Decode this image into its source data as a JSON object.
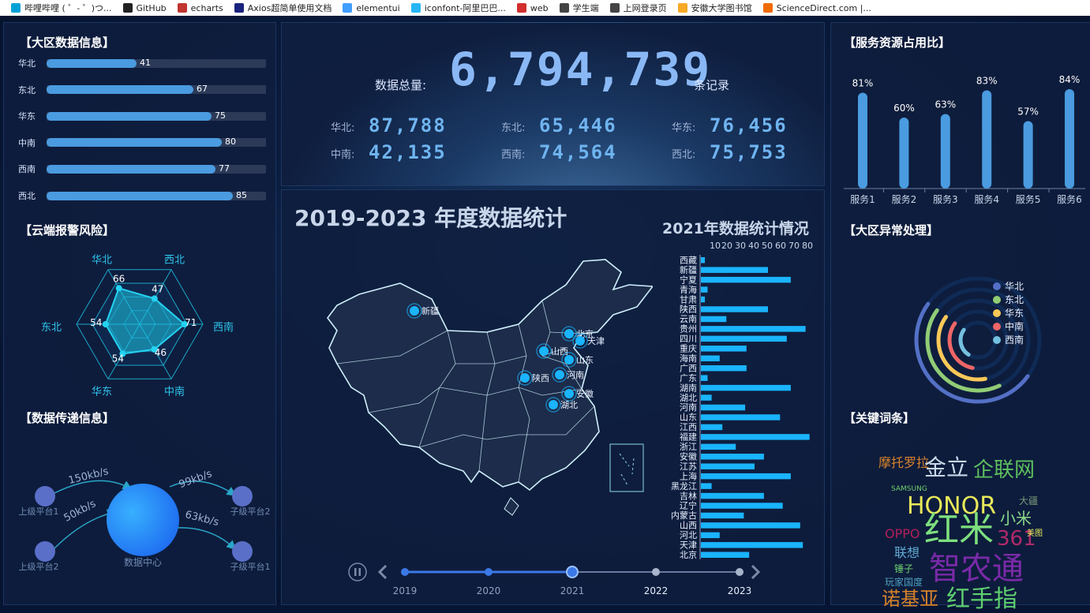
{
  "bookmarks": [
    {
      "label": "哔哩哔哩 ( ゜- ゜)つ...",
      "color": "#00a1d6"
    },
    {
      "label": "GitHub",
      "color": "#222222"
    },
    {
      "label": "echarts",
      "color": "#c23531"
    },
    {
      "label": "Axios超简单使用文档",
      "color": "#1a237e"
    },
    {
      "label": "elementui",
      "color": "#409eff"
    },
    {
      "label": "iconfont-阿里巴巴...",
      "color": "#29b6f6"
    },
    {
      "label": "web",
      "color": "#d32f2f"
    },
    {
      "label": "学生端",
      "color": "#444444"
    },
    {
      "label": "上网登录页",
      "color": "#444444"
    },
    {
      "label": "安徽大学图书馆",
      "color": "#f9a825"
    },
    {
      "label": "ScienceDirect.com |...",
      "color": "#ef6c00"
    }
  ],
  "left": {
    "region_title": "【大区数据信息】",
    "region_bars": [
      {
        "label": "华北",
        "value": 41
      },
      {
        "label": "东北",
        "value": 67
      },
      {
        "label": "华东",
        "value": 75
      },
      {
        "label": "中南",
        "value": 80
      },
      {
        "label": "西南",
        "value": 77
      },
      {
        "label": "西北",
        "value": 85
      }
    ],
    "radar_title": "【云端报警风险】",
    "radar": {
      "axes": [
        "华北",
        "西北",
        "西南",
        "中南",
        "华东",
        "东北"
      ],
      "values": [
        66,
        47,
        71,
        46,
        54,
        54
      ]
    },
    "transfer_title": "【数据传递信息】",
    "transfer": {
      "center": "数据中心",
      "nodes": [
        "上级平台1",
        "上级平台2",
        "子级平台2",
        "子级平台1"
      ],
      "rates": [
        "150kb/s",
        "50kb/s",
        "99kb/s",
        "63kb/s"
      ]
    }
  },
  "top": {
    "total_label": "数据总量:",
    "total_value": "6,794,739",
    "total_unit": "条记录",
    "regions": [
      {
        "label": "华北:",
        "value": "87,788"
      },
      {
        "label": "东北:",
        "value": "65,446"
      },
      {
        "label": "华东:",
        "value": "76,456"
      },
      {
        "label": "中南:",
        "value": "42,135"
      },
      {
        "label": "西南:",
        "value": "74,564"
      },
      {
        "label": "西北:",
        "value": "75,753"
      }
    ]
  },
  "map": {
    "title": "2019-2023 年度数据统计",
    "subtitle": "2021年数据统计情况",
    "cities": [
      "新疆",
      "北京",
      "天津",
      "山西",
      "山东",
      "陕西",
      "河南",
      "安徽",
      "湖北"
    ],
    "years": [
      "2019",
      "2020",
      "2021",
      "2022",
      "2023"
    ],
    "current_year": "2021"
  },
  "chart_data": [
    {
      "type": "bar",
      "title": "",
      "xlabel": "",
      "ylabel": "",
      "categories": [
        "华北",
        "东北",
        "华东",
        "中南",
        "西南",
        "西北"
      ],
      "values": [
        41,
        67,
        75,
        80,
        77,
        85
      ]
    },
    {
      "type": "radar",
      "title": "",
      "categories": [
        "华北",
        "西北",
        "西南",
        "中南",
        "华东",
        "东北"
      ],
      "values": [
        66,
        47,
        71,
        46,
        54,
        54
      ]
    },
    {
      "type": "bar",
      "title": "2021年数据统计情况",
      "orientation": "horizontal",
      "xlim": [
        0,
        80
      ],
      "xticks": [
        10,
        20,
        30,
        40,
        50,
        60,
        70,
        80
      ],
      "categories": [
        "西藏",
        "新疆",
        "宁夏",
        "青海",
        "甘肃",
        "陕西",
        "云南",
        "贵州",
        "四川",
        "重庆",
        "海南",
        "广西",
        "广东",
        "湖南",
        "湖北",
        "河南",
        "山东",
        "江西",
        "福建",
        "浙江",
        "安徽",
        "江苏",
        "上海",
        "黑龙江",
        "吉林",
        "辽宁",
        "内蒙古",
        "山西",
        "河北",
        "天津",
        "北京"
      ],
      "values": [
        3,
        50,
        67,
        5,
        3,
        50,
        19,
        78,
        64,
        34,
        14,
        34,
        5,
        67,
        8,
        33,
        59,
        16,
        81,
        26,
        47,
        40,
        67,
        8,
        47,
        61,
        32,
        74,
        14,
        76,
        36
      ]
    },
    {
      "type": "bar",
      "title": "",
      "categories": [
        "服务1",
        "服务2",
        "服务3",
        "服务4",
        "服务5",
        "服务6"
      ],
      "values": [
        81,
        60,
        63,
        83,
        57,
        84
      ],
      "labels": [
        "81%",
        "60%",
        "63%",
        "83%",
        "57%",
        "84%"
      ]
    },
    {
      "type": "pie",
      "title": "",
      "legend": [
        "华北",
        "东北",
        "华东",
        "中南",
        "西南"
      ],
      "colors": [
        "#5470c6",
        "#91cc75",
        "#fac858",
        "#ee6666",
        "#73c0de"
      ]
    }
  ],
  "right": {
    "service_title": "【服务资源占用比】",
    "anomaly_title": "【大区异常处理】",
    "keyword_title": "【关键词条】",
    "keywords": [
      {
        "text": "摩托罗拉",
        "color": "#d8832a"
      },
      {
        "text": "金立",
        "color": "#c8d8e8"
      },
      {
        "text": "企联网",
        "color": "#5fbf5f"
      },
      {
        "text": "SAMSUNG",
        "color": "#6fcf6f"
      },
      {
        "text": "HONOR",
        "color": "#e8e85a"
      },
      {
        "text": "大疆",
        "color": "#7a9a7a"
      },
      {
        "text": "小米",
        "color": "#8ad88a"
      },
      {
        "text": "红米",
        "color": "#7ee07e"
      },
      {
        "text": "OPPO",
        "color": "#b0205a"
      },
      {
        "text": "361",
        "color": "#b02a6a"
      },
      {
        "text": "美图",
        "color": "#e8e85a"
      },
      {
        "text": "联想",
        "color": "#5fa8d0"
      },
      {
        "text": "锤子",
        "color": "#6fcf6f"
      },
      {
        "text": "智农通",
        "color": "#7a2aa8"
      },
      {
        "text": "玩家国度",
        "color": "#4f9fc0"
      },
      {
        "text": "诺基亚",
        "color": "#d8832a"
      },
      {
        "text": "红手指",
        "color": "#5fcf6f"
      }
    ]
  }
}
